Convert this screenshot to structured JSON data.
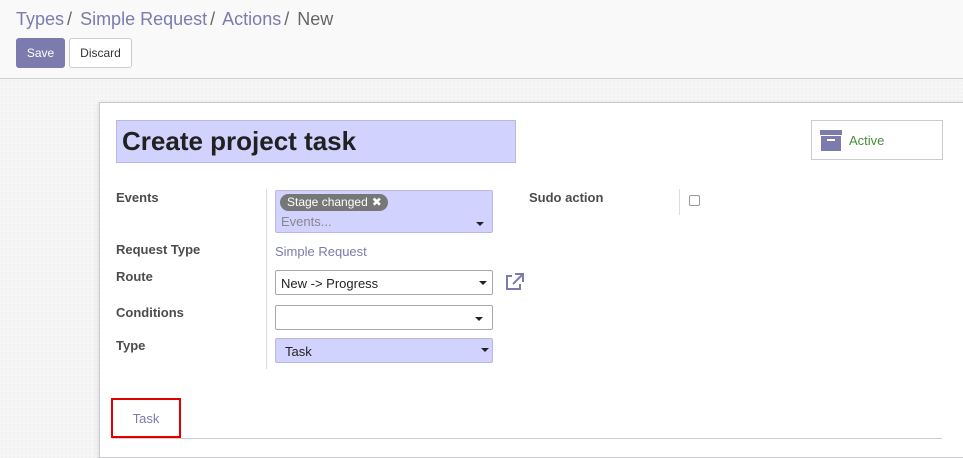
{
  "breadcrumb": [
    {
      "label": "Types"
    },
    {
      "label": "Simple Request"
    },
    {
      "label": "Actions"
    },
    {
      "label": "New"
    }
  ],
  "breadcrumb_separator": "/",
  "buttons": {
    "save": "Save",
    "discard": "Discard"
  },
  "form": {
    "name": "Create project task",
    "active_label": "Active",
    "fields": {
      "events": {
        "label": "Events",
        "tags": [
          "Stage changed"
        ],
        "placeholder": "Events..."
      },
      "sudo_action": {
        "label": "Sudo action",
        "checked": false
      },
      "request_type": {
        "label": "Request Type",
        "value": "Simple Request"
      },
      "route": {
        "label": "Route",
        "value": "New -> Progress"
      },
      "conditions": {
        "label": "Conditions",
        "value": ""
      },
      "type": {
        "label": "Type",
        "value": "Task"
      }
    },
    "tabs": [
      {
        "label": "Task"
      }
    ]
  },
  "colors": {
    "primary": "#7c7bad",
    "field_required": "#d2d2ff",
    "active_green": "#4a8a3a",
    "highlight": "#e00000"
  },
  "icons": {
    "tag_remove": "close-icon",
    "archive": "archive-box-icon",
    "external": "external-link-icon"
  }
}
